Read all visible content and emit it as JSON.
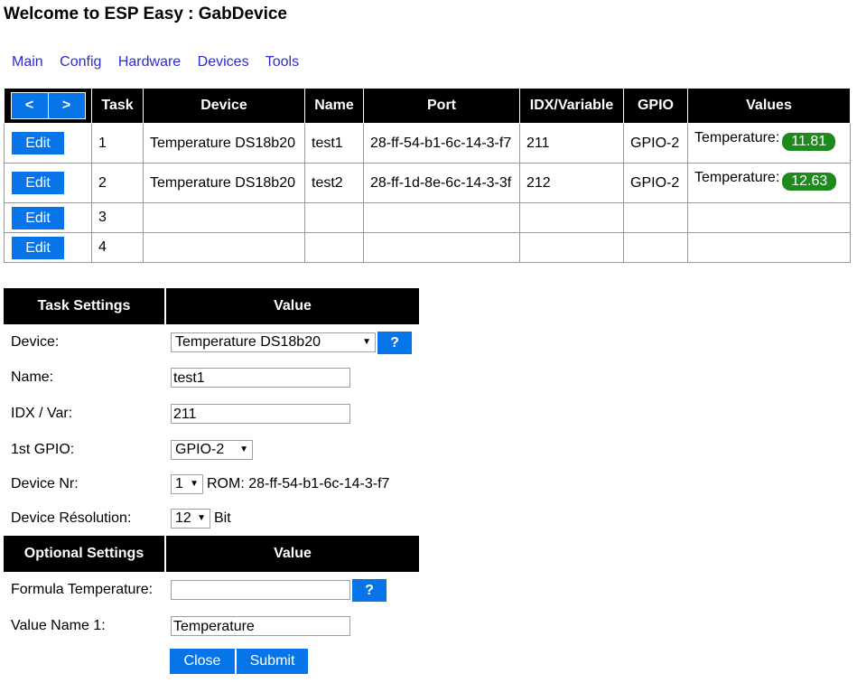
{
  "page": {
    "title": "Welcome to ESP Easy : GabDevice"
  },
  "nav": [
    "Main",
    "Config",
    "Hardware",
    "Devices",
    "Tools"
  ],
  "tasks_table": {
    "pager": {
      "prev": "<",
      "next": ">"
    },
    "headers": {
      "task": "Task",
      "device": "Device",
      "name": "Name",
      "port": "Port",
      "idx": "IDX/Variable",
      "gpio": "GPIO",
      "values": "Values"
    },
    "edit_label": "Edit",
    "rows": [
      {
        "task": "1",
        "device": "Temperature DS18b20",
        "name": "test1",
        "port": "28-ff-54-b1-6c-14-3-f7",
        "idx": "211",
        "gpio": "GPIO-2",
        "value_name": "Temperature:",
        "value": "11.81"
      },
      {
        "task": "2",
        "device": "Temperature DS18b20",
        "name": "test2",
        "port": "28-ff-1d-8e-6c-14-3-3f",
        "idx": "212",
        "gpio": "GPIO-2",
        "value_name": "Temperature:",
        "value": "12.63"
      },
      {
        "task": "3"
      },
      {
        "task": "4"
      }
    ]
  },
  "settings": {
    "task_header": "Task Settings",
    "value_header": "Value",
    "device_label": "Device:",
    "device_value": "Temperature DS18b20",
    "help_label": "?",
    "name_label": "Name:",
    "name_value": "test1",
    "idx_label": "IDX / Var:",
    "idx_value": "211",
    "gpio_label": "1st GPIO:",
    "gpio_value": "GPIO-2",
    "device_nr_label": "Device Nr:",
    "device_nr_value": "1",
    "rom_text": "ROM: 28-ff-54-b1-6c-14-3-f7",
    "resolution_label": "Device Résolution:",
    "resolution_value": "12",
    "resolution_unit": "Bit",
    "optional_header": "Optional Settings",
    "formula_label": "Formula Temperature:",
    "formula_value": "",
    "value_name_label": "Value Name 1:",
    "value_name_value": "Temperature"
  },
  "actions": {
    "close": "Close",
    "submit": "Submit"
  },
  "colors": {
    "accent": "#0775e8",
    "badge": "#1e8a1e",
    "header_bg": "#000000",
    "link": "#2b2bd0"
  },
  "icons": {
    "dropdown": "triangle-down-icon"
  }
}
